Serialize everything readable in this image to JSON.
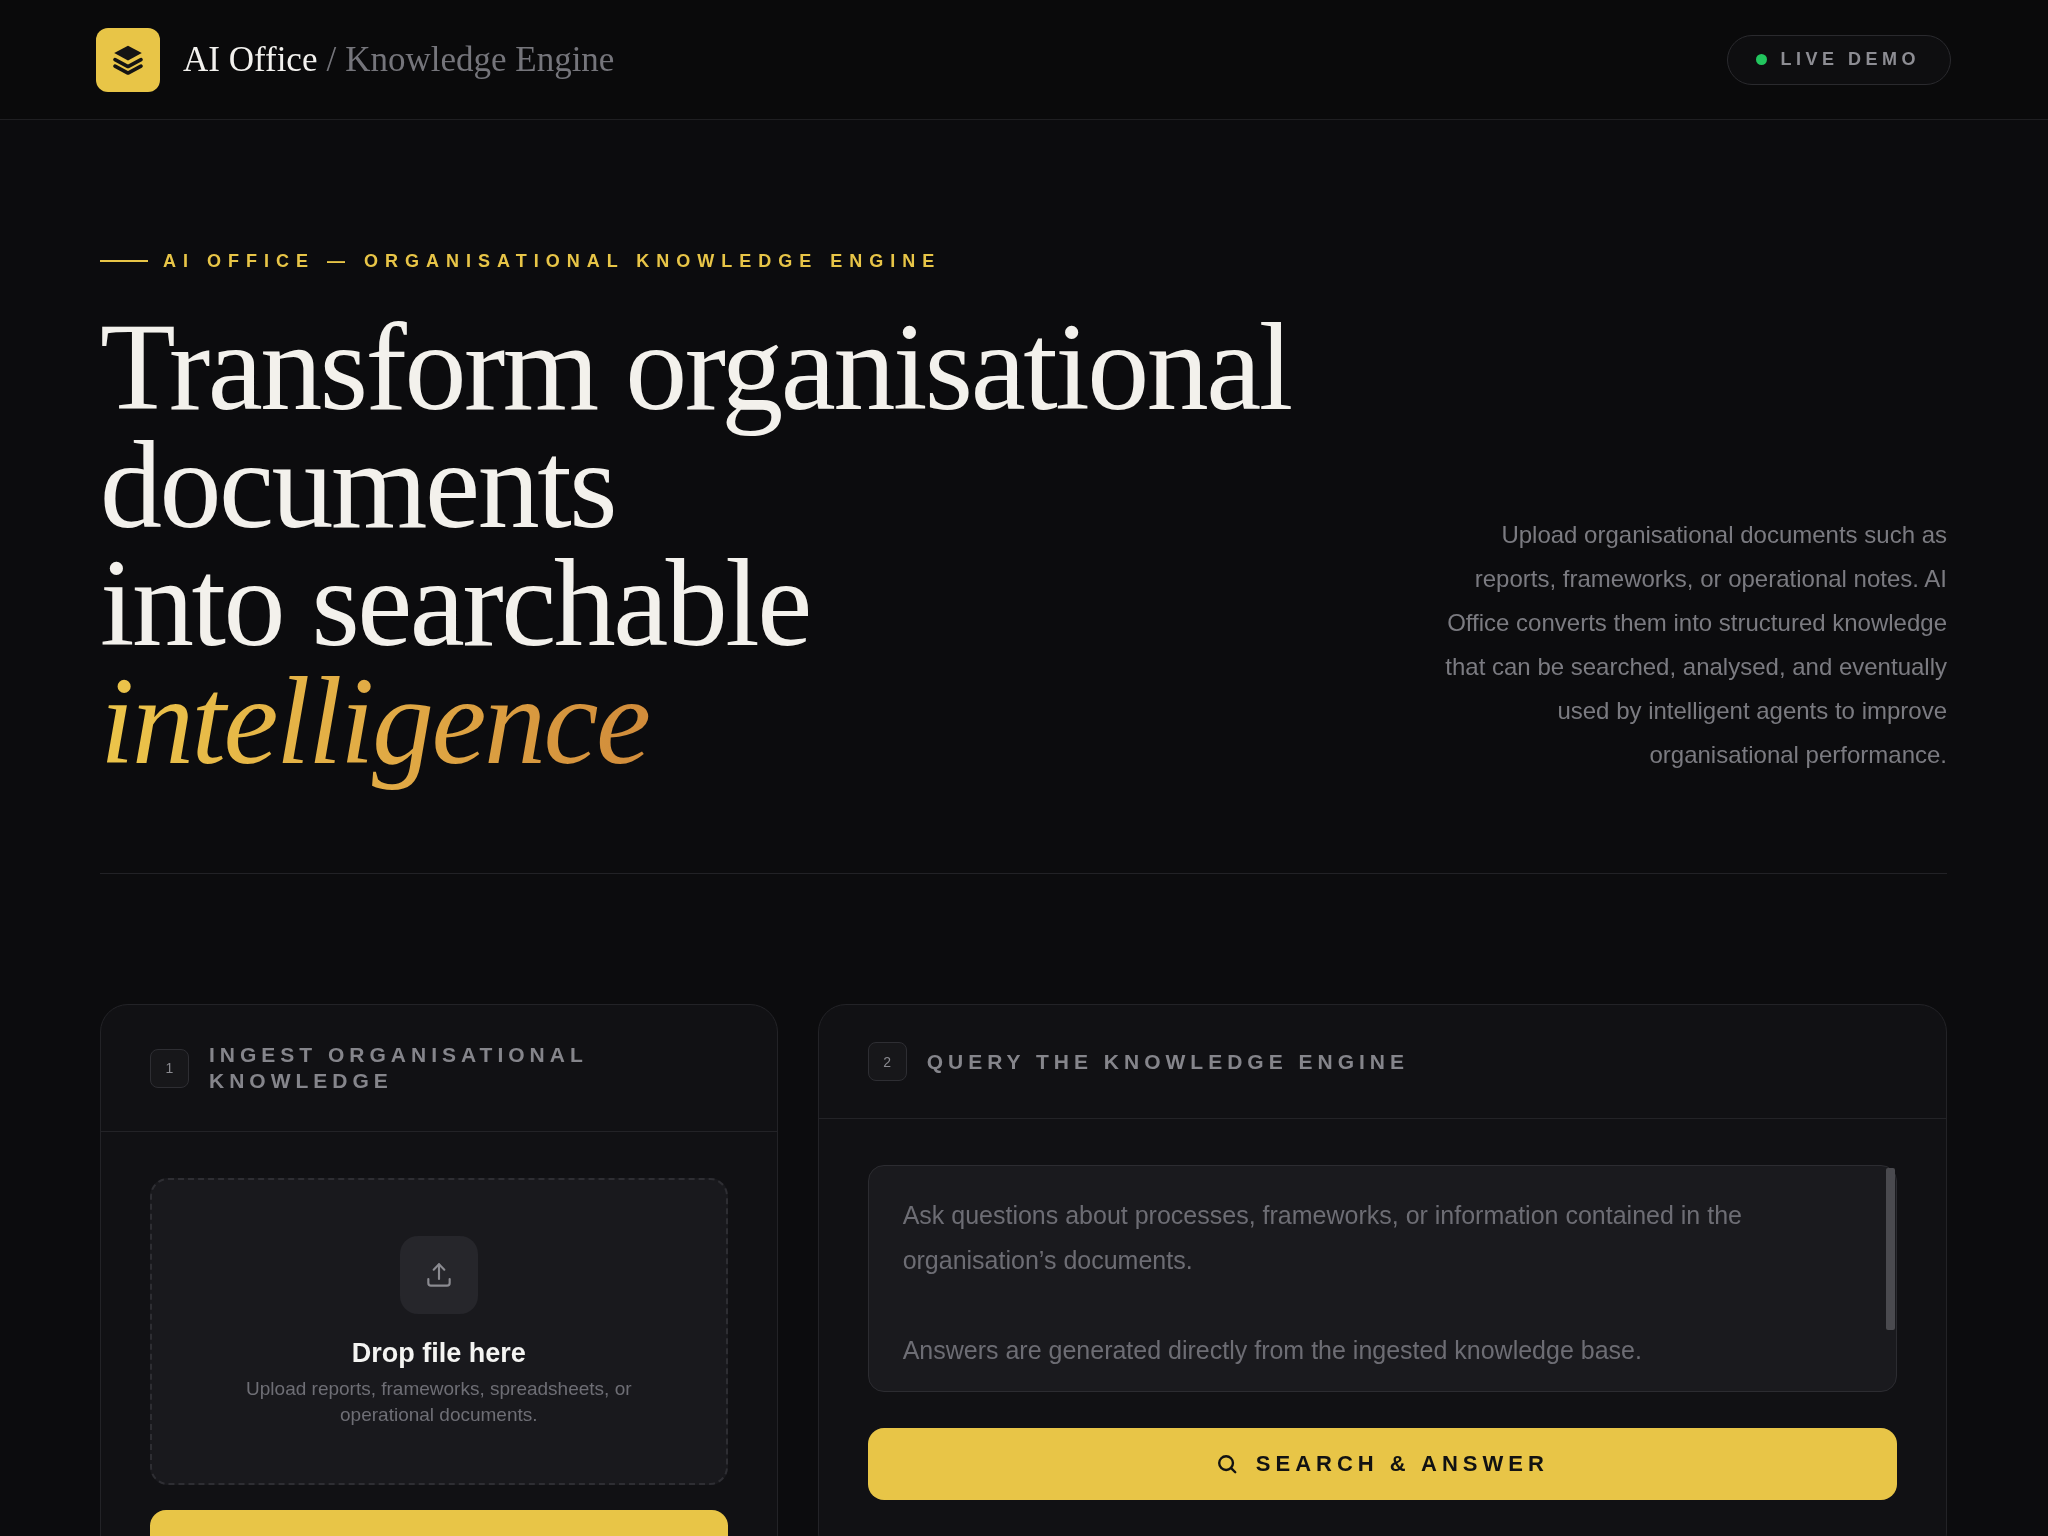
{
  "header": {
    "brand": {
      "name": "AI Office",
      "separator": "/",
      "section": "Knowledge Engine"
    },
    "status_badge": {
      "label": "LIVE DEMO"
    }
  },
  "hero": {
    "eyebrow": "AI OFFICE — ORGANISATIONAL KNOWLEDGE ENGINE",
    "title": "Transform organisational\ndocuments\ninto searchable\n*intelligence*",
    "description": "Upload organisational documents such as reports, frameworks, or operational notes. AI Office converts them into structured knowledge that can be searched, analysed, and eventually used by intelligent agents to improve organisational performance."
  },
  "steps": [
    {
      "kind": "ingest",
      "number": "1",
      "title": "INGEST ORGANISATIONAL KNOWLEDGE",
      "dropzone": {
        "title": "Drop file here",
        "hint": "Upload reports, frameworks, spreadsheets, or operational documents."
      }
    },
    {
      "kind": "query",
      "number": "2",
      "title": "QUERY THE KNOWLEDGE ENGINE",
      "query_field": {
        "placeholder": "Ask questions about processes, frameworks, or information contained in the organisation’s documents.\n\nAnswers are generated directly from the ingested knowledge base."
      },
      "button": {
        "label": "SEARCH & ANSWER"
      }
    }
  ]
}
